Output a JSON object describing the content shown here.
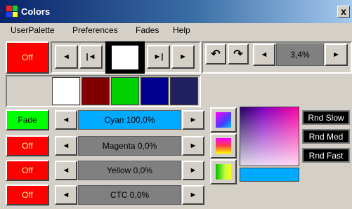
{
  "window": {
    "title": "Colors",
    "close": "x"
  },
  "menu": [
    "UserPalette",
    "Preferences",
    "Fades",
    "Help"
  ],
  "transport": {
    "prev": "◄",
    "first": "|◄",
    "last": "►|",
    "next": "►"
  },
  "rotate": {
    "ccw": "↶",
    "cw": "↷",
    "dec": "◄",
    "value": "3,4%",
    "inc": "►"
  },
  "palette_colors": [
    "#ffffff",
    "#800000",
    "#00d000",
    "#000090",
    "#202060"
  ],
  "channels": [
    {
      "toggle": "Fade",
      "toggle_on": true,
      "label": "Cyan 100,0%",
      "color": "#00aaff"
    },
    {
      "toggle": "Off",
      "toggle_on": false,
      "label": "Magenta 0,0%",
      "color": "#808080"
    },
    {
      "toggle": "Off",
      "toggle_on": false,
      "label": "Yellow 0,0%",
      "color": "#808080"
    },
    {
      "toggle": "Off",
      "toggle_on": false,
      "label": "CTC 0,0%",
      "color": "#808080"
    }
  ],
  "master_toggle": "Off",
  "random": [
    "Rnd Slow",
    "Rnd Med",
    "Rnd Fast"
  ],
  "current_color": "#00aaff"
}
